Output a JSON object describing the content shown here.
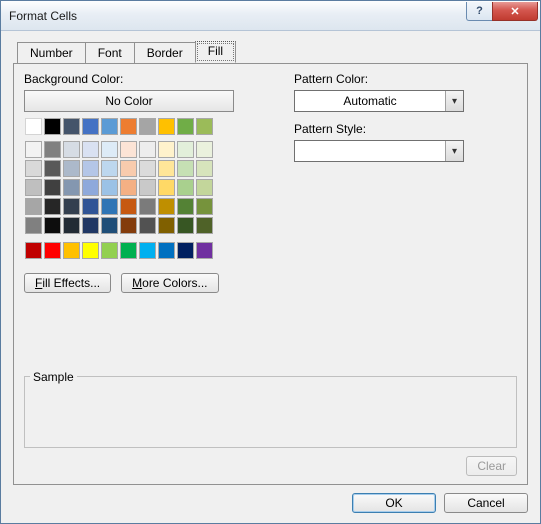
{
  "window": {
    "title": "Format Cells"
  },
  "tabs": {
    "number": "Number",
    "font": "Font",
    "border": "Border",
    "fill": "Fill",
    "active": "fill"
  },
  "fill": {
    "bg_label": "Background Color:",
    "no_color": "No Color",
    "fill_effects": "Fill Effects...",
    "more_colors": "More Colors...",
    "pattern_color_label": "Pattern Color:",
    "pattern_color_value": "Automatic",
    "pattern_style_label": "Pattern Style:",
    "pattern_style_value": "",
    "sample_label": "Sample",
    "clear": "Clear"
  },
  "buttons": {
    "ok": "OK",
    "cancel": "Cancel"
  },
  "theme_row1": [
    "#FFFFFF",
    "#000000",
    "#44546A",
    "#4472C4",
    "#5B9BD5",
    "#ED7D31",
    "#A5A5A5",
    "#FFC000",
    "#70AD47",
    "#9BBB59"
  ],
  "theme_rows": [
    [
      "#F2F2F2",
      "#808080",
      "#D6DCE4",
      "#D9E1F2",
      "#DDEBF7",
      "#FCE4D6",
      "#EDEDED",
      "#FFF2CC",
      "#E2EFDA",
      "#EAF1DD"
    ],
    [
      "#D9D9D9",
      "#595959",
      "#ACB9CA",
      "#B4C6E7",
      "#BDD7EE",
      "#F8CBAD",
      "#DBDBDB",
      "#FFE699",
      "#C6E0B4",
      "#D7E4BC"
    ],
    [
      "#BFBFBF",
      "#404040",
      "#8497B0",
      "#8EA9DB",
      "#9BC2E6",
      "#F4B084",
      "#C9C9C9",
      "#FFD966",
      "#A9D08E",
      "#C3D69B"
    ],
    [
      "#A6A6A6",
      "#262626",
      "#333F4F",
      "#305496",
      "#2F75B5",
      "#C65911",
      "#7B7B7B",
      "#BF8F00",
      "#548235",
      "#76933C"
    ],
    [
      "#808080",
      "#0D0D0D",
      "#222B35",
      "#203764",
      "#1F4E78",
      "#833C0C",
      "#525252",
      "#806000",
      "#375623",
      "#4F6228"
    ]
  ],
  "standard": [
    "#C00000",
    "#FF0000",
    "#FFC000",
    "#FFFF00",
    "#92D050",
    "#00B050",
    "#00B0F0",
    "#0070C0",
    "#002060",
    "#7030A0"
  ]
}
